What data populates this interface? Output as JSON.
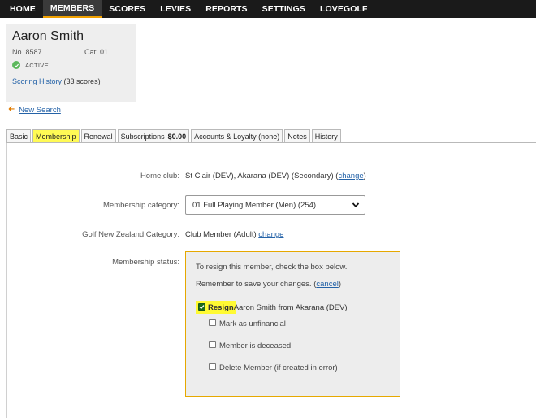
{
  "nav": {
    "items": [
      "HOME",
      "MEMBERS",
      "SCORES",
      "LEVIES",
      "REPORTS",
      "SETTINGS",
      "LOVEGOLF"
    ],
    "active": "MEMBERS"
  },
  "member": {
    "name": "Aaron Smith",
    "number": "No. 8587",
    "category": "Cat: 01",
    "status": "ACTIVE",
    "scoring_history_link": "Scoring History",
    "scoring_history_count": "(33 scores)"
  },
  "new_search": "New Search",
  "tabs": {
    "basic": "Basic",
    "membership": "Membership",
    "renewal": "Renewal",
    "subscriptions": "Subscriptions",
    "subscriptions_amount": "$0.00",
    "accounts": "Accounts & Loyalty (none)",
    "notes": "Notes",
    "history": "History"
  },
  "form": {
    "home_club_label": "Home club:",
    "home_club_value": "St Clair (DEV), Akarana (DEV) (Secondary) (",
    "home_club_change": "change",
    "home_club_close": ")",
    "category_label": "Membership category:",
    "category_value": "01 Full Playing Member (Men) (254)",
    "gnz_label": "Golf New Zealand Category:",
    "gnz_value": "Club Member (Adult)",
    "gnz_change": "change",
    "status_label": "Membership status:"
  },
  "status_box": {
    "line1": "To resign this member, check the box below.",
    "line2_prefix": "Remember to save your changes. (",
    "cancel": "cancel",
    "line2_suffix": ")",
    "resign_bold": "Resign",
    "resign_rest": " Aaron Smith from Akarana (DEV)",
    "opt_unfinancial": "Mark as unfinancial",
    "opt_deceased": "Member is deceased",
    "opt_delete": "Delete Member (if created in error)"
  },
  "colors": {
    "nav_bg": "#1a1a1a",
    "highlight": "#fffa55",
    "link": "#2563a8",
    "status_border": "#e6a800",
    "active_green": "#5cb85c"
  }
}
